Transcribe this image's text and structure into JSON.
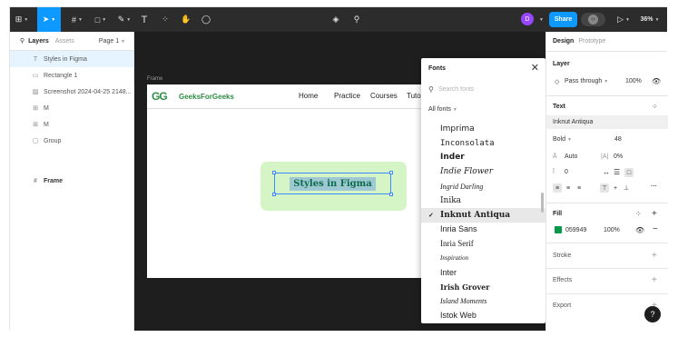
{
  "toolbar": {
    "zoom": "36%",
    "share_label": "Share",
    "avatar_initial": "D",
    "text_tool": "T",
    "accent": "#0d99ff"
  },
  "left_panel": {
    "tabs": {
      "layers": "Layers",
      "assets": "Assets",
      "page": "Page 1"
    },
    "frame_name": "Frame",
    "layers": [
      {
        "icon": "T",
        "name": "Styles in Figma",
        "selected": true
      },
      {
        "icon": "▭",
        "name": "Rectangle 1"
      },
      {
        "icon": "▨",
        "name": "Screenshot 2024-04-25 2148..."
      },
      {
        "icon": "⊞",
        "name": "M"
      },
      {
        "icon": "⊞",
        "name": "M"
      },
      {
        "icon": "▢",
        "name": "Group"
      }
    ]
  },
  "canvas": {
    "frame_label": "Frame",
    "logo_icon": "GG",
    "logo_text": "GeeksForGeeks",
    "nav": [
      "Home",
      "Practice",
      "Courses",
      "Tuto"
    ],
    "card_text": "Styles in Figma"
  },
  "fonts_popup": {
    "title": "Fonts",
    "search_placeholder": "Search fonts",
    "filter": "All fonts",
    "items": [
      {
        "name": "Imprima"
      },
      {
        "name": "Inconsolata"
      },
      {
        "name": "Inder"
      },
      {
        "name": "Indie Flower"
      },
      {
        "name": "Ingrid Darling"
      },
      {
        "name": "Inika"
      },
      {
        "name": "Inknut Antiqua",
        "selected": true
      },
      {
        "name": "Inria Sans"
      },
      {
        "name": "Inria Serif"
      },
      {
        "name": "Inspiration"
      },
      {
        "name": "Inter"
      },
      {
        "name": "Irish Grover"
      },
      {
        "name": "Island Moments"
      },
      {
        "name": "Istok Web"
      }
    ]
  },
  "right_panel": {
    "tabs": {
      "design": "Design",
      "prototype": "Prototype"
    },
    "layer_title": "Layer",
    "blend": "Pass through",
    "opacity": "100%",
    "text_title": "Text",
    "font_name": "Inknut Antiqua",
    "weight": "Bold",
    "size": "48",
    "line_height": "Auto",
    "letter_spacing": "0%",
    "paragraph": "0",
    "fill_title": "Fill",
    "fill_hex": "059949",
    "fill_opacity": "100%",
    "fill_color": "#059949",
    "stroke_title": "Stroke",
    "effects_title": "Effects",
    "export_title": "Export",
    "help": "?"
  }
}
